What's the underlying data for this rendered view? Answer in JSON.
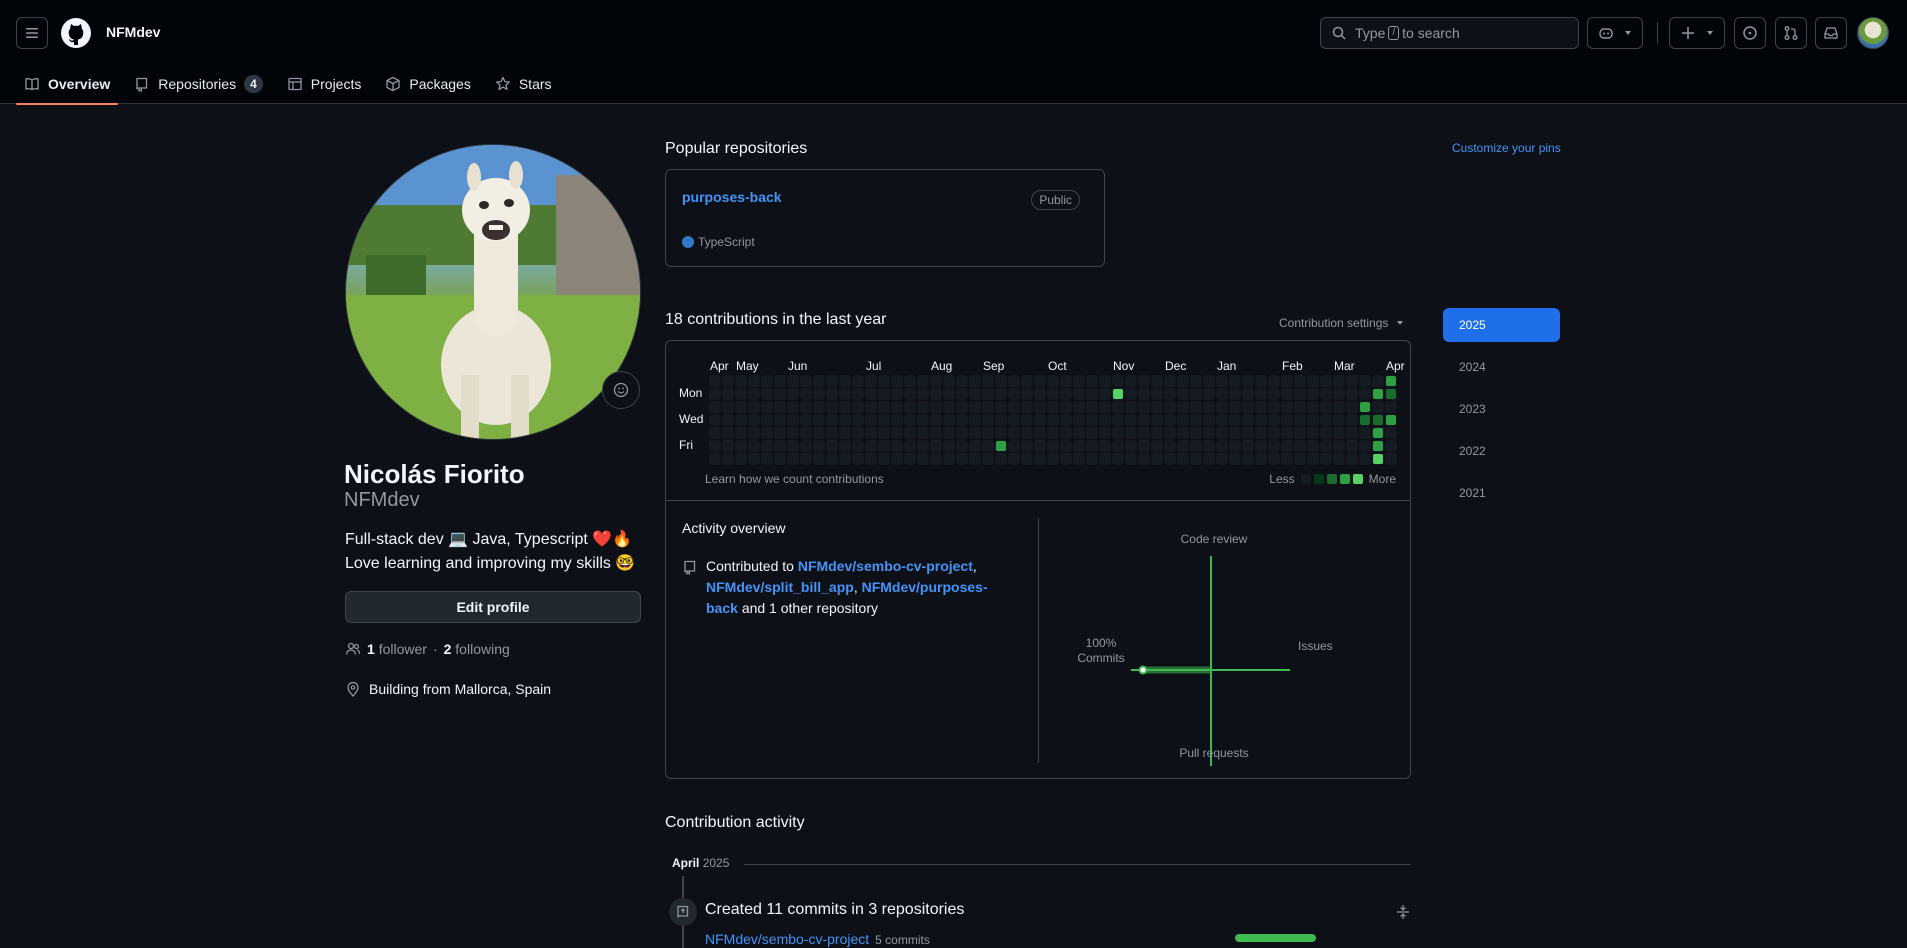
{
  "header": {
    "owner": "NFMdev",
    "search_before": "Type",
    "search_key": "/",
    "search_after": "to search"
  },
  "tabs": [
    {
      "label": "Overview",
      "icon": "book-icon",
      "active": true
    },
    {
      "label": "Repositories",
      "icon": "repo-icon",
      "count": "4"
    },
    {
      "label": "Projects",
      "icon": "table-icon"
    },
    {
      "label": "Packages",
      "icon": "package-icon"
    },
    {
      "label": "Stars",
      "icon": "star-icon"
    }
  ],
  "profile": {
    "full_name": "Nicolás Fiorito",
    "login": "NFMdev",
    "bio_line1": "Full-stack dev 💻 Java, Typescript ❤️🔥",
    "bio_line2": "Love learning and improving my skills 🤓",
    "edit_label": "Edit profile",
    "followers_count": "1",
    "followers_label": "follower",
    "dot": "·",
    "following_count": "2",
    "following_label": "following",
    "location": "Building from Mallorca, Spain"
  },
  "popular": {
    "title": "Popular repositories",
    "customize": "Customize your pins",
    "repos": [
      {
        "name": "purposes-back",
        "visibility": "Public",
        "language": "TypeScript",
        "language_color": "#3178c6"
      }
    ]
  },
  "contributions": {
    "title": "18 contributions in the last year",
    "settings": "Contribution settings",
    "months": [
      "Apr",
      "May",
      "Jun",
      "Jul",
      "Aug",
      "Sep",
      "Oct",
      "Nov",
      "Dec",
      "Jan",
      "Feb",
      "Mar",
      "Apr"
    ],
    "days": [
      "Mon",
      "Wed",
      "Fri"
    ],
    "learn": "Learn how we count contributions",
    "legend_less": "Less",
    "legend_more": "More",
    "legend_colors": [
      "#151b23",
      "#033a16",
      "#196c2e",
      "#2ea043",
      "#56d364"
    ],
    "active_cells": [
      {
        "week": 31,
        "day": 1,
        "level": 4
      },
      {
        "week": 52,
        "day": 0,
        "level": 3
      },
      {
        "week": 51,
        "day": 1,
        "level": 3
      },
      {
        "week": 52,
        "day": 1,
        "level": 2
      },
      {
        "week": 50,
        "day": 2,
        "level": 3
      },
      {
        "week": 50,
        "day": 3,
        "level": 2
      },
      {
        "week": 51,
        "day": 3,
        "level": 2
      },
      {
        "week": 52,
        "day": 3,
        "level": 3
      },
      {
        "week": 51,
        "day": 4,
        "level": 3
      },
      {
        "week": 22,
        "day": 5,
        "level": 3
      },
      {
        "week": 51,
        "day": 5,
        "level": 3
      },
      {
        "week": 51,
        "day": 6,
        "level": 4
      }
    ]
  },
  "activity_overview": {
    "title": "Activity overview",
    "contributed_to": "Contributed to",
    "repo1": "NFMdev/sembo-cv-project",
    "repo2": "NFMdev/split_bill_app",
    "repo3": "NFMdev/purposes-back",
    "suffix": "and 1 other repository",
    "axes": {
      "top": "Code review",
      "right": "Issues",
      "bottom": "Pull requests",
      "left_pct": "100%",
      "left": "Commits"
    }
  },
  "contribution_activity": {
    "title": "Contribution activity",
    "month": "April",
    "year": "2025",
    "event_title": "Created 11 commits in 3 repositories",
    "rows": [
      {
        "repo": "NFMdev/sembo-cv-project",
        "commits": "5 commits",
        "share": 1.0
      }
    ]
  },
  "years": [
    "2025",
    "2024",
    "2023",
    "2022",
    "2021"
  ],
  "active_year": "2025",
  "colors": {
    "accent": "#4493f8",
    "tab_underline": "#f78166",
    "green": "#3fb950",
    "year_active": "#1f6feb"
  }
}
